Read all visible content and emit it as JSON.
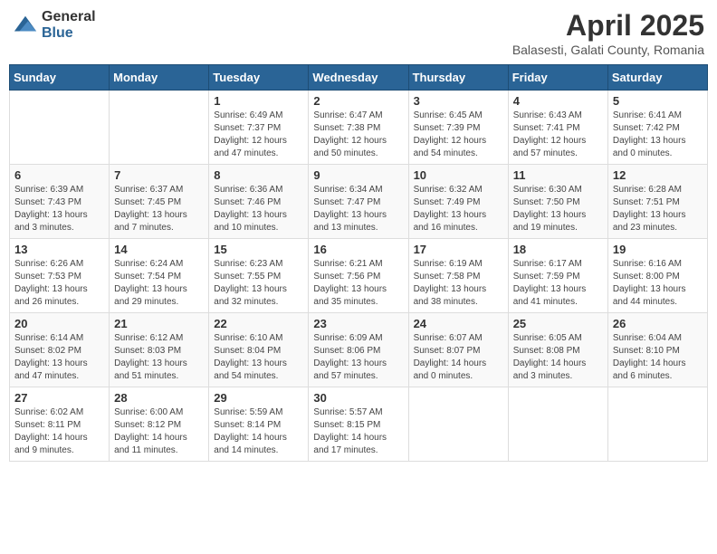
{
  "logo": {
    "general": "General",
    "blue": "Blue"
  },
  "header": {
    "month": "April 2025",
    "location": "Balasesti, Galati County, Romania"
  },
  "weekdays": [
    "Sunday",
    "Monday",
    "Tuesday",
    "Wednesday",
    "Thursday",
    "Friday",
    "Saturday"
  ],
  "weeks": [
    [
      {
        "day": "",
        "info": ""
      },
      {
        "day": "",
        "info": ""
      },
      {
        "day": "1",
        "info": "Sunrise: 6:49 AM\nSunset: 7:37 PM\nDaylight: 12 hours\nand 47 minutes."
      },
      {
        "day": "2",
        "info": "Sunrise: 6:47 AM\nSunset: 7:38 PM\nDaylight: 12 hours\nand 50 minutes."
      },
      {
        "day": "3",
        "info": "Sunrise: 6:45 AM\nSunset: 7:39 PM\nDaylight: 12 hours\nand 54 minutes."
      },
      {
        "day": "4",
        "info": "Sunrise: 6:43 AM\nSunset: 7:41 PM\nDaylight: 12 hours\nand 57 minutes."
      },
      {
        "day": "5",
        "info": "Sunrise: 6:41 AM\nSunset: 7:42 PM\nDaylight: 13 hours\nand 0 minutes."
      }
    ],
    [
      {
        "day": "6",
        "info": "Sunrise: 6:39 AM\nSunset: 7:43 PM\nDaylight: 13 hours\nand 3 minutes."
      },
      {
        "day": "7",
        "info": "Sunrise: 6:37 AM\nSunset: 7:45 PM\nDaylight: 13 hours\nand 7 minutes."
      },
      {
        "day": "8",
        "info": "Sunrise: 6:36 AM\nSunset: 7:46 PM\nDaylight: 13 hours\nand 10 minutes."
      },
      {
        "day": "9",
        "info": "Sunrise: 6:34 AM\nSunset: 7:47 PM\nDaylight: 13 hours\nand 13 minutes."
      },
      {
        "day": "10",
        "info": "Sunrise: 6:32 AM\nSunset: 7:49 PM\nDaylight: 13 hours\nand 16 minutes."
      },
      {
        "day": "11",
        "info": "Sunrise: 6:30 AM\nSunset: 7:50 PM\nDaylight: 13 hours\nand 19 minutes."
      },
      {
        "day": "12",
        "info": "Sunrise: 6:28 AM\nSunset: 7:51 PM\nDaylight: 13 hours\nand 23 minutes."
      }
    ],
    [
      {
        "day": "13",
        "info": "Sunrise: 6:26 AM\nSunset: 7:53 PM\nDaylight: 13 hours\nand 26 minutes."
      },
      {
        "day": "14",
        "info": "Sunrise: 6:24 AM\nSunset: 7:54 PM\nDaylight: 13 hours\nand 29 minutes."
      },
      {
        "day": "15",
        "info": "Sunrise: 6:23 AM\nSunset: 7:55 PM\nDaylight: 13 hours\nand 32 minutes."
      },
      {
        "day": "16",
        "info": "Sunrise: 6:21 AM\nSunset: 7:56 PM\nDaylight: 13 hours\nand 35 minutes."
      },
      {
        "day": "17",
        "info": "Sunrise: 6:19 AM\nSunset: 7:58 PM\nDaylight: 13 hours\nand 38 minutes."
      },
      {
        "day": "18",
        "info": "Sunrise: 6:17 AM\nSunset: 7:59 PM\nDaylight: 13 hours\nand 41 minutes."
      },
      {
        "day": "19",
        "info": "Sunrise: 6:16 AM\nSunset: 8:00 PM\nDaylight: 13 hours\nand 44 minutes."
      }
    ],
    [
      {
        "day": "20",
        "info": "Sunrise: 6:14 AM\nSunset: 8:02 PM\nDaylight: 13 hours\nand 47 minutes."
      },
      {
        "day": "21",
        "info": "Sunrise: 6:12 AM\nSunset: 8:03 PM\nDaylight: 13 hours\nand 51 minutes."
      },
      {
        "day": "22",
        "info": "Sunrise: 6:10 AM\nSunset: 8:04 PM\nDaylight: 13 hours\nand 54 minutes."
      },
      {
        "day": "23",
        "info": "Sunrise: 6:09 AM\nSunset: 8:06 PM\nDaylight: 13 hours\nand 57 minutes."
      },
      {
        "day": "24",
        "info": "Sunrise: 6:07 AM\nSunset: 8:07 PM\nDaylight: 14 hours\nand 0 minutes."
      },
      {
        "day": "25",
        "info": "Sunrise: 6:05 AM\nSunset: 8:08 PM\nDaylight: 14 hours\nand 3 minutes."
      },
      {
        "day": "26",
        "info": "Sunrise: 6:04 AM\nSunset: 8:10 PM\nDaylight: 14 hours\nand 6 minutes."
      }
    ],
    [
      {
        "day": "27",
        "info": "Sunrise: 6:02 AM\nSunset: 8:11 PM\nDaylight: 14 hours\nand 9 minutes."
      },
      {
        "day": "28",
        "info": "Sunrise: 6:00 AM\nSunset: 8:12 PM\nDaylight: 14 hours\nand 11 minutes."
      },
      {
        "day": "29",
        "info": "Sunrise: 5:59 AM\nSunset: 8:14 PM\nDaylight: 14 hours\nand 14 minutes."
      },
      {
        "day": "30",
        "info": "Sunrise: 5:57 AM\nSunset: 8:15 PM\nDaylight: 14 hours\nand 17 minutes."
      },
      {
        "day": "",
        "info": ""
      },
      {
        "day": "",
        "info": ""
      },
      {
        "day": "",
        "info": ""
      }
    ]
  ]
}
